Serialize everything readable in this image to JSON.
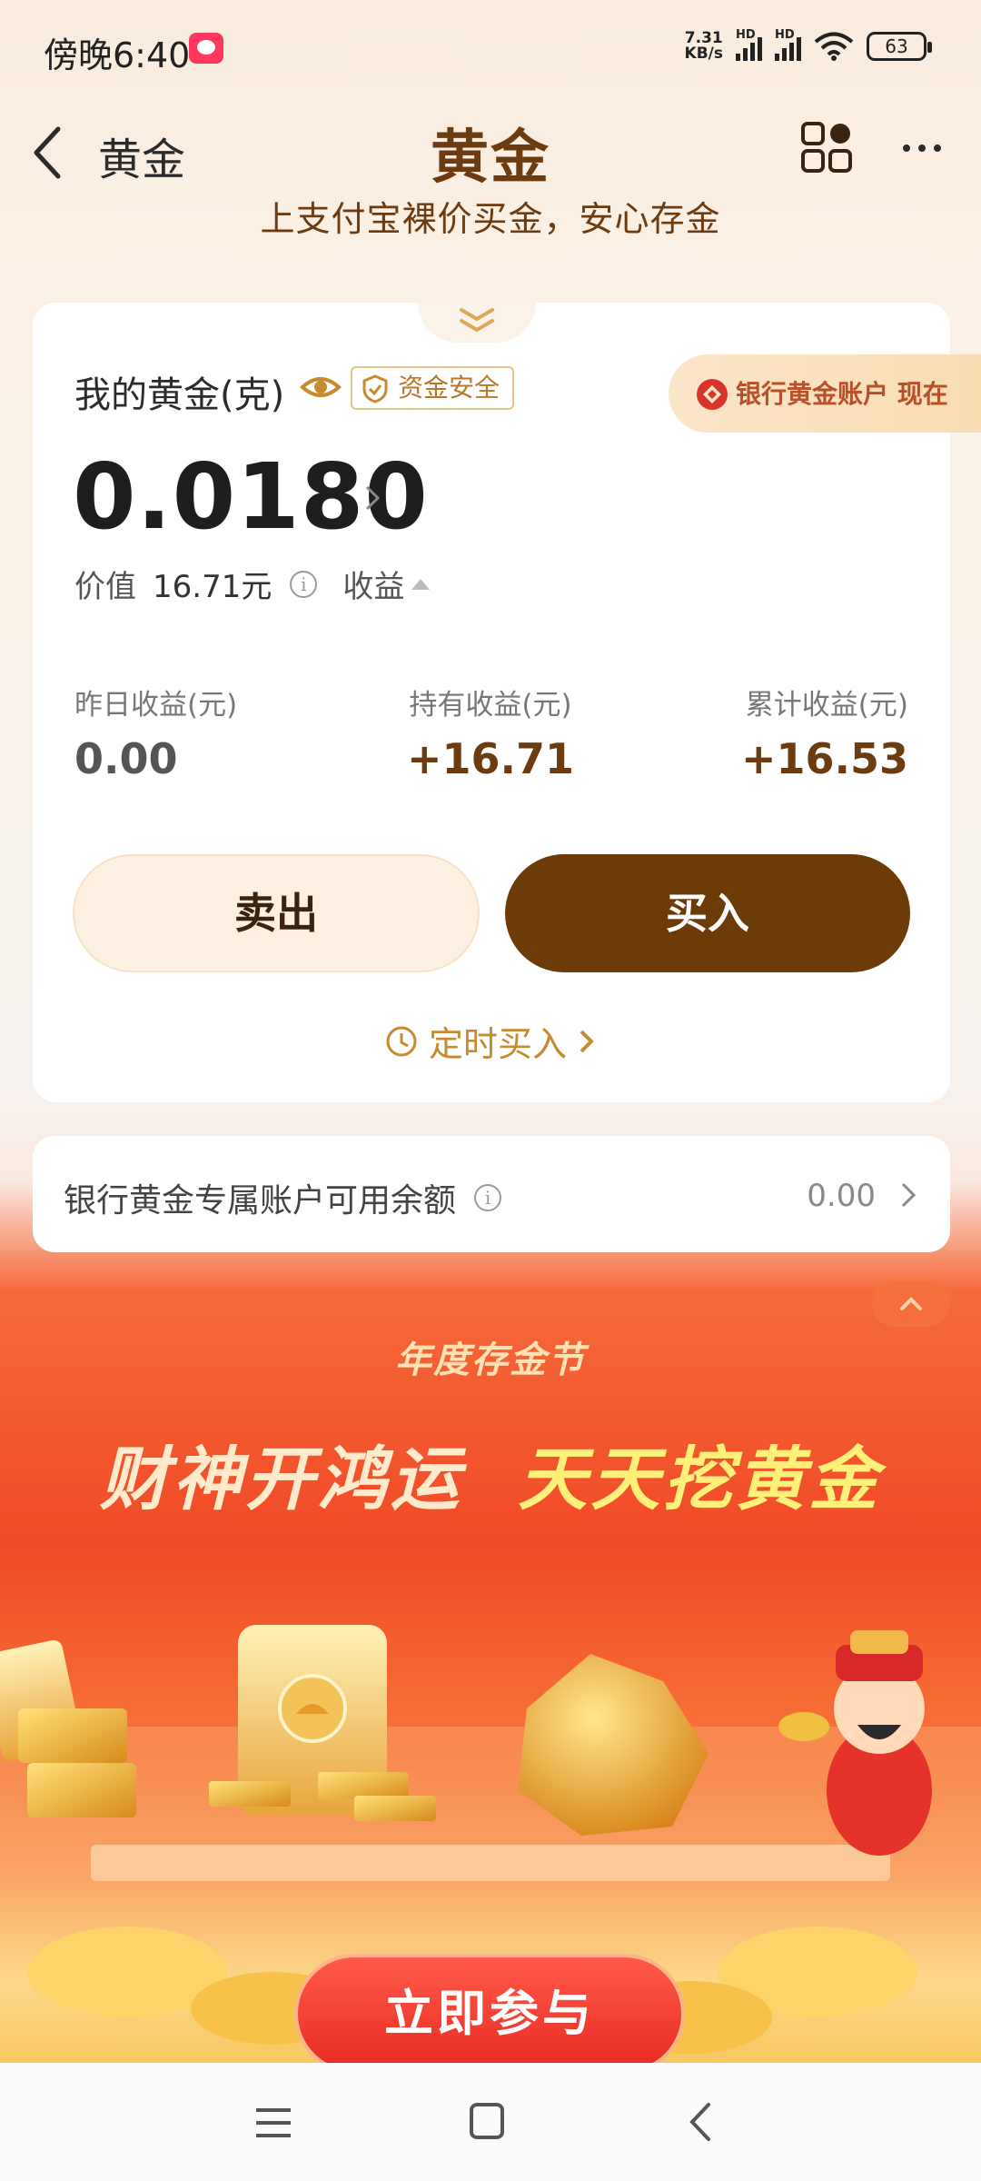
{
  "status_bar": {
    "time": "傍晚6:40",
    "net_speed_value": "7.31",
    "net_speed_unit": "KB/s",
    "signal_1_label": "HD",
    "signal_2_label": "HD",
    "battery": "63"
  },
  "header": {
    "back_label": "黄金",
    "title": "黄金",
    "subtitle": "上支付宝裸价买金，安心存金"
  },
  "card": {
    "my_gold_label": "我的黄金(克)",
    "safe_badge": "资金安全",
    "bank_pill": "银行黄金账户 现在",
    "amount": "0.0180",
    "value_label": "价值",
    "value": "16.71元",
    "earnings_toggle": "收益",
    "stats": {
      "yesterday_label": "昨日收益(元)",
      "yesterday_value": "0.00",
      "hold_label": "持有收益(元)",
      "hold_value": "+16.71",
      "total_label": "累计收益(元)",
      "total_value": "+16.53"
    },
    "sell_label": "卖出",
    "buy_label": "买入",
    "schedule_label": "定时买入"
  },
  "balance": {
    "label": "银行黄金专属账户可用余额",
    "value": "0.00"
  },
  "promo": {
    "festival": "年度存金节",
    "title_part1": "财神开鸿运",
    "title_part2": "天天挖黄金",
    "join_label": "立即参与"
  },
  "colors": {
    "brand_brown": "#6d3b07",
    "accent_gold": "#c78a2e",
    "promo_red": "#f04a26"
  }
}
